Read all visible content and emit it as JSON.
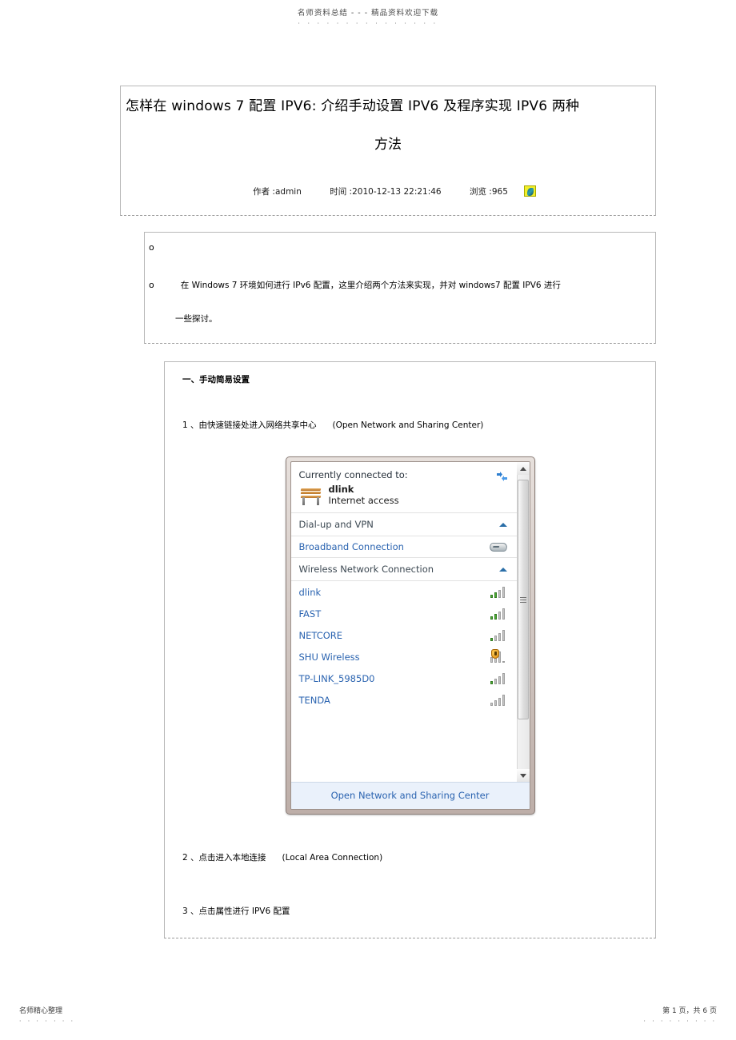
{
  "watermark": {
    "top_text": "名师资料总结 - - - 精品资料欢迎下载",
    "top_dots": "· · · · · · · · · · · · · · ·"
  },
  "article": {
    "title_line1": "怎样在  windows 7    配置 IPV6: 介绍手动设置   IPV6  及程序实现  IPV6  两种",
    "title_line2": "方法",
    "meta": {
      "author": "作者 :admin",
      "time": "时间 :2010-12-13 22:21:46",
      "views": "浏览 :965",
      "views_icon_name": "feed-icon"
    }
  },
  "intro": {
    "bullet1": "o",
    "bullet2": "o",
    "paragraph": "在 Windows 7   环境如何进行   IPv6 配置，这里介绍两个方法来实现，并对        windows7  配置  IPV6 进行",
    "paragraph_cont": "一些探讨。"
  },
  "steps": {
    "heading": "一、手动简易设置",
    "step1_cn": "1 、由快速链接处进入网络共享中心",
    "step1_en": "(Open Network and Sharing Center)",
    "step2_cn": "2 、点击进入本地连接",
    "step2_en": "(Local Area Connection)",
    "step3_cn": "3 、点击属性进行   IPV6 配置"
  },
  "win_flyout": {
    "connected_label": "Currently connected to:",
    "connected_network": "dlink",
    "connected_status": "Internet access",
    "refresh_icon_name": "network-refresh-icon",
    "bench_icon_name": "home-network-bench-icon",
    "sections": [
      {
        "header": "Dial-up and VPN",
        "chevron": "chevron-up-icon",
        "rows": [
          {
            "label": "Broadband Connection",
            "icon": "modem-icon"
          }
        ]
      },
      {
        "header": "Wireless Network Connection",
        "chevron": "chevron-up-icon",
        "rows": [
          {
            "label": "dlink",
            "icon": "signal-bars-icon",
            "strength": 2,
            "secured": false
          },
          {
            "label": "FAST",
            "icon": "signal-bars-icon",
            "strength": 2,
            "secured": false
          },
          {
            "label": "NETCORE",
            "icon": "signal-bars-icon",
            "strength": 1,
            "secured": false
          },
          {
            "label": "SHU Wireless",
            "icon": "signal-bars-icon",
            "strength": 1,
            "secured": true
          },
          {
            "label": "TP-LINK_5985D0",
            "icon": "signal-bars-icon",
            "strength": 1,
            "secured": false
          },
          {
            "label": "TENDA",
            "icon": "signal-bars-icon",
            "strength": 0,
            "secured": false
          }
        ]
      }
    ],
    "footer_action": "Open Network and Sharing Center",
    "scrollbar": {
      "up_icon": "scroll-up-arrow-icon",
      "down_icon": "scroll-down-arrow-icon",
      "grip_icon": "scroll-thumb-grip-icon"
    }
  },
  "page_footer": {
    "left_text": "名师精心整理",
    "left_dots": "· · · · · · ·",
    "right_text": "第 1 页，共 6 页",
    "right_dots": "· · · · · · · · ·"
  }
}
